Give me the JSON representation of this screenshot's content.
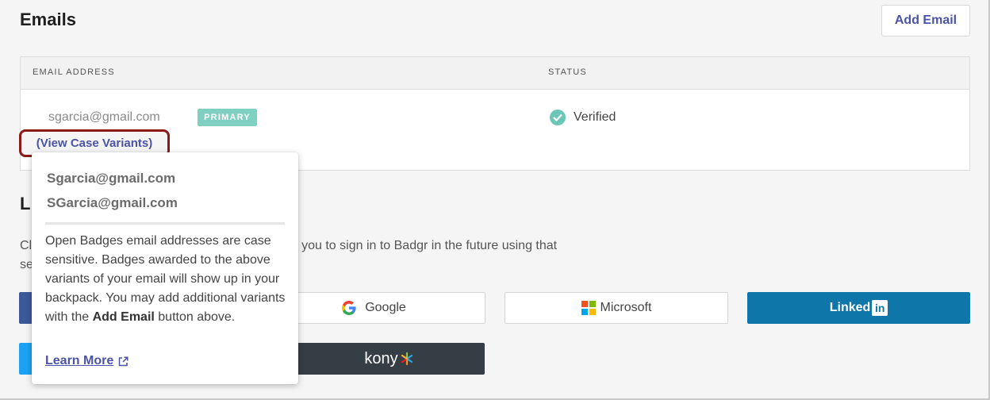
{
  "emails_section": {
    "title": "Emails",
    "add_button": "Add Email",
    "table": {
      "columns": [
        "EMAIL ADDRESS",
        "STATUS"
      ],
      "rows": [
        {
          "email": "sgarcia@gmail.com",
          "badge": "PRIMARY",
          "status": "Verified"
        }
      ]
    },
    "variants_link": "(View Case Variants)"
  },
  "popover": {
    "variants": [
      "Sgarcia@gmail.com",
      "SGarcia@gmail.com"
    ],
    "text_before": "Open Badges email addresses are case sensitive. Badges awarded to the above variants of your email will show up in your backpack. You may add additional variants with the ",
    "text_bold": "Add Email",
    "text_after": " button above.",
    "learn_more": "Learn More"
  },
  "linked_section": {
    "title_visible": "Li",
    "desc_line1_left": "Cli",
    "desc_line1_right": "y you to sign in to Badgr in the future using that",
    "desc_line2_left": "se"
  },
  "providers": {
    "google": "Google",
    "microsoft": "Microsoft",
    "linkedin": "Linked",
    "linkedin_in": "in",
    "kony": "kony"
  },
  "colors": {
    "accent": "#4a53a6",
    "badge": "#7fcfc2",
    "verified": "#6cc6b7",
    "highlight_border": "#8a1b1b",
    "linkedin": "#0e76a8",
    "kony": "#353d45"
  }
}
